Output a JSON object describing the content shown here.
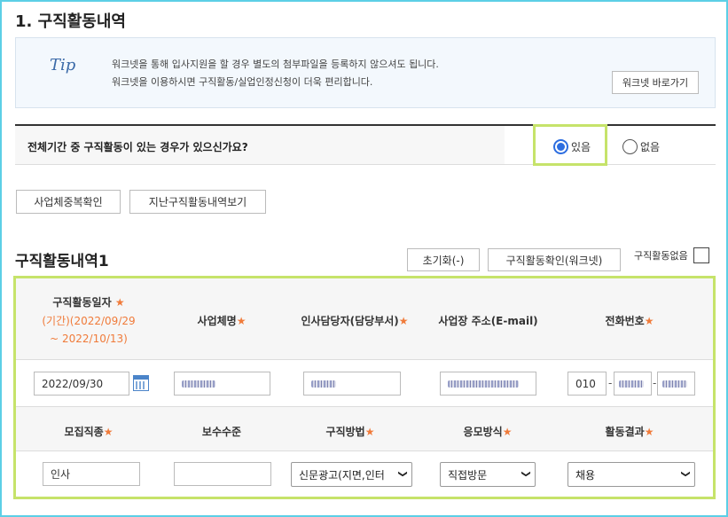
{
  "section": {
    "title": "1. 구직활동내역"
  },
  "tip": {
    "label": "Tip",
    "line1": "워크넷을 통해 입사지원을 할 경우 별도의 첨부파일을 등록하지 않으셔도 됩니다.",
    "line2": "워크넷을 이용하시면 구직활동/실업인정신청이 더욱 편리합니다.",
    "worknet_button": "워크넷 바로가기"
  },
  "question": {
    "text": "전체기간 중 구직활동이 있는 경우가 있으신가요?",
    "options": [
      "있음",
      "없음"
    ],
    "selected": "있음"
  },
  "actions": {
    "duplicate_check": "사업체중복확인",
    "past_history": "지난구직활동내역보기"
  },
  "activity": {
    "title": "구직활동내역1",
    "reset_button": "초기화(-)",
    "confirm_button": "구직활동확인(워크넷)",
    "none_label": "구직활동없음",
    "headers1": {
      "date": "구직활동일자",
      "period": "(기간)(2022/09/29",
      "period2": "~ 2022/10/13)",
      "company": "사업체명",
      "manager": "인사담당자(담당부서)",
      "address": "사업장 주소(E-mail)",
      "phone": "전화번호"
    },
    "row1": {
      "date": "2022/09/30",
      "phone_prefix": "010"
    },
    "headers2": {
      "job": "모집직종",
      "pay": "보수수준",
      "method": "구직방법",
      "apply": "응모방식",
      "result": "활동결과"
    },
    "row2": {
      "job": "인사",
      "pay": "",
      "method": "신문광고(지면,인터",
      "apply": "직접방문",
      "result": "채용"
    },
    "star": "★"
  },
  "colors": {
    "accent": "#2c6de0",
    "highlight": "#c6e36a",
    "required": "#f07b3a"
  }
}
